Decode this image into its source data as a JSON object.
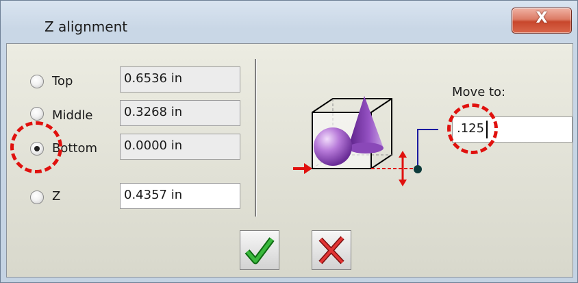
{
  "window": {
    "title": "Z alignment",
    "close_label": "X"
  },
  "options": [
    {
      "key": "top",
      "label": "Top",
      "value": "0.6536 in",
      "checked": false,
      "editable": false
    },
    {
      "key": "middle",
      "label": "Middle",
      "value": "0.3268 in",
      "checked": false,
      "editable": false
    },
    {
      "key": "bottom",
      "label": "Bottom",
      "value": "0.0000 in",
      "checked": true,
      "editable": false
    },
    {
      "key": "z",
      "label": "Z",
      "value": "0.4357 in",
      "checked": false,
      "editable": true
    }
  ],
  "move_to": {
    "label": "Move to:",
    "value": ".125"
  },
  "icons": {
    "ok": "green-check-icon",
    "cancel": "red-x-icon",
    "preview": "z-alignment-diagram-icon"
  },
  "colors": {
    "highlight": "#e0110e",
    "shape": "#9b55c8",
    "arrow": "#e0110e",
    "connector": "#1a1aa0"
  }
}
